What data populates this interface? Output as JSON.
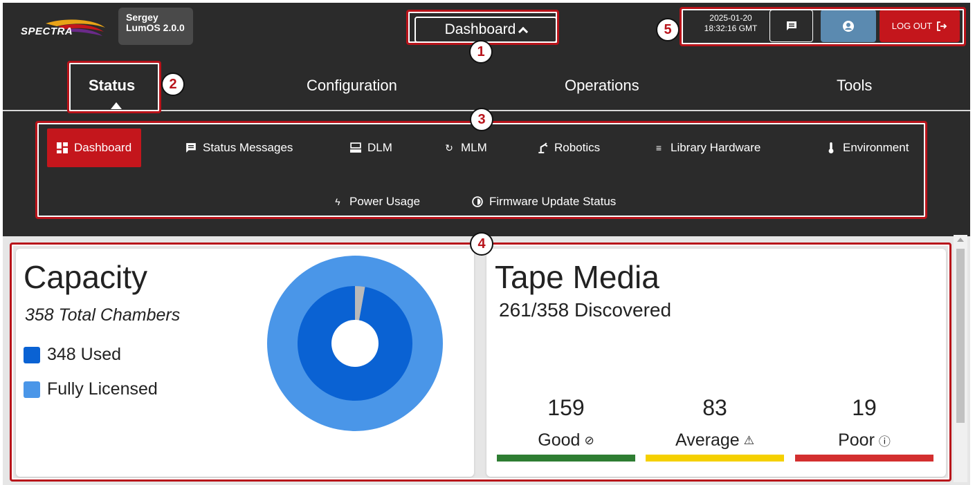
{
  "header": {
    "logo_text": "SPECTRA",
    "user_name": "Sergey",
    "version": "LumOS 2.0.0",
    "menu_label": "Dashboard",
    "date": "2025-01-20",
    "time": "18:32:16 GMT",
    "logout_label": "LOG OUT"
  },
  "main_tabs": [
    {
      "label": "Status",
      "active": true
    },
    {
      "label": "Configuration"
    },
    {
      "label": "Operations"
    },
    {
      "label": "Tools"
    }
  ],
  "sub_nav": [
    {
      "label": "Dashboard",
      "icon": "dashboard-icon",
      "active": true
    },
    {
      "label": "Status Messages",
      "icon": "message-icon"
    },
    {
      "label": "DLM",
      "icon": "drive-icon"
    },
    {
      "label": "MLM",
      "icon": "refresh-icon"
    },
    {
      "label": "Robotics",
      "icon": "robot-arm-icon"
    },
    {
      "label": "Library Hardware",
      "icon": "list-icon"
    },
    {
      "label": "Environment",
      "icon": "thermometer-icon"
    },
    {
      "label": "Power Usage",
      "icon": "lightning-icon"
    },
    {
      "label": "Firmware Update Status",
      "icon": "half-circle-icon"
    }
  ],
  "capacity": {
    "title": "Capacity",
    "total": "358 Total Chambers",
    "used_label": "348 Used",
    "licensed_label": "Fully Licensed",
    "total_chambers": 358,
    "used_chambers": 348
  },
  "tape_media": {
    "title": "Tape Media",
    "discovered": "261/358 Discovered",
    "stats": [
      {
        "value": "159",
        "label": "Good",
        "icon": "check-circle-icon",
        "color": "#2e7d32"
      },
      {
        "value": "83",
        "label": "Average",
        "icon": "warning-icon",
        "color": "#f5d000"
      },
      {
        "value": "19",
        "label": "Poor",
        "icon": "exclamation-circle-icon",
        "color": "#d32f2f"
      }
    ]
  },
  "annotations": [
    "1",
    "2",
    "3",
    "4",
    "5"
  ],
  "colors": {
    "accent": "#c4161c",
    "used": "#0a62d3",
    "licensed": "#4a96e8",
    "unused": "#b9b9b9"
  }
}
